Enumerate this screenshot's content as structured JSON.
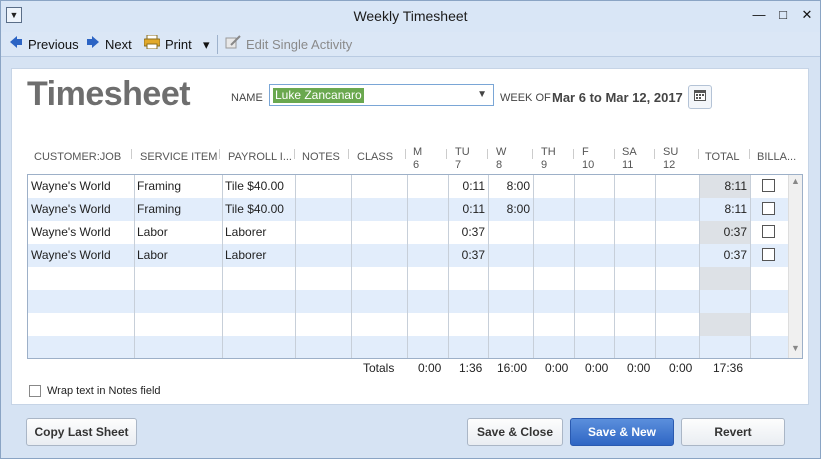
{
  "window": {
    "title": "Weekly Timesheet"
  },
  "toolbar": {
    "previous_label": "Previous",
    "next_label": "Next",
    "print_label": "Print",
    "edit_single_label": "Edit Single Activity"
  },
  "header": {
    "title": "Timesheet",
    "name_label": "NAME",
    "name_value": "Luke Zancanaro",
    "week_of_label": "WEEK OF",
    "week_range": "Mar 6 to Mar 12, 2017"
  },
  "columns": {
    "customer": "CUSTOMER:JOB",
    "service": "SERVICE ITEM",
    "payroll": "PAYROLL I...",
    "notes": "NOTES",
    "class": "CLASS",
    "m_day": "M",
    "m_date": "6",
    "tu_day": "TU",
    "tu_date": "7",
    "w_day": "W",
    "w_date": "8",
    "th_day": "TH",
    "th_date": "9",
    "f_day": "F",
    "f_date": "10",
    "sa_day": "SA",
    "sa_date": "11",
    "su_day": "SU",
    "su_date": "12",
    "total": "TOTAL",
    "billable": "BILLA..."
  },
  "rows": [
    {
      "customer": "Wayne's World",
      "service": "Framing",
      "payroll": "Tile $40.00",
      "tu": "0:11",
      "w": "8:00",
      "total": "8:11"
    },
    {
      "customer": "Wayne's World",
      "service": "Framing",
      "payroll": "Tile $40.00",
      "tu": "0:11",
      "w": "8:00",
      "total": "8:11"
    },
    {
      "customer": "Wayne's World",
      "service": "Labor",
      "payroll": "Laborer",
      "tu": "0:37",
      "w": "",
      "total": "0:37"
    },
    {
      "customer": "Wayne's World",
      "service": "Labor",
      "payroll": "Laborer",
      "tu": "0:37",
      "w": "",
      "total": "0:37"
    }
  ],
  "totals": {
    "label": "Totals",
    "m": "0:00",
    "tu": "1:36",
    "w": "16:00",
    "th": "0:00",
    "f": "0:00",
    "sa": "0:00",
    "su": "0:00",
    "total": "17:36"
  },
  "options": {
    "wrap_text_label": "Wrap text in Notes field"
  },
  "footer": {
    "copy_last_label": "Copy Last Sheet",
    "save_close_label": "Save & Close",
    "save_new_label": "Save & New",
    "revert_label": "Revert"
  }
}
